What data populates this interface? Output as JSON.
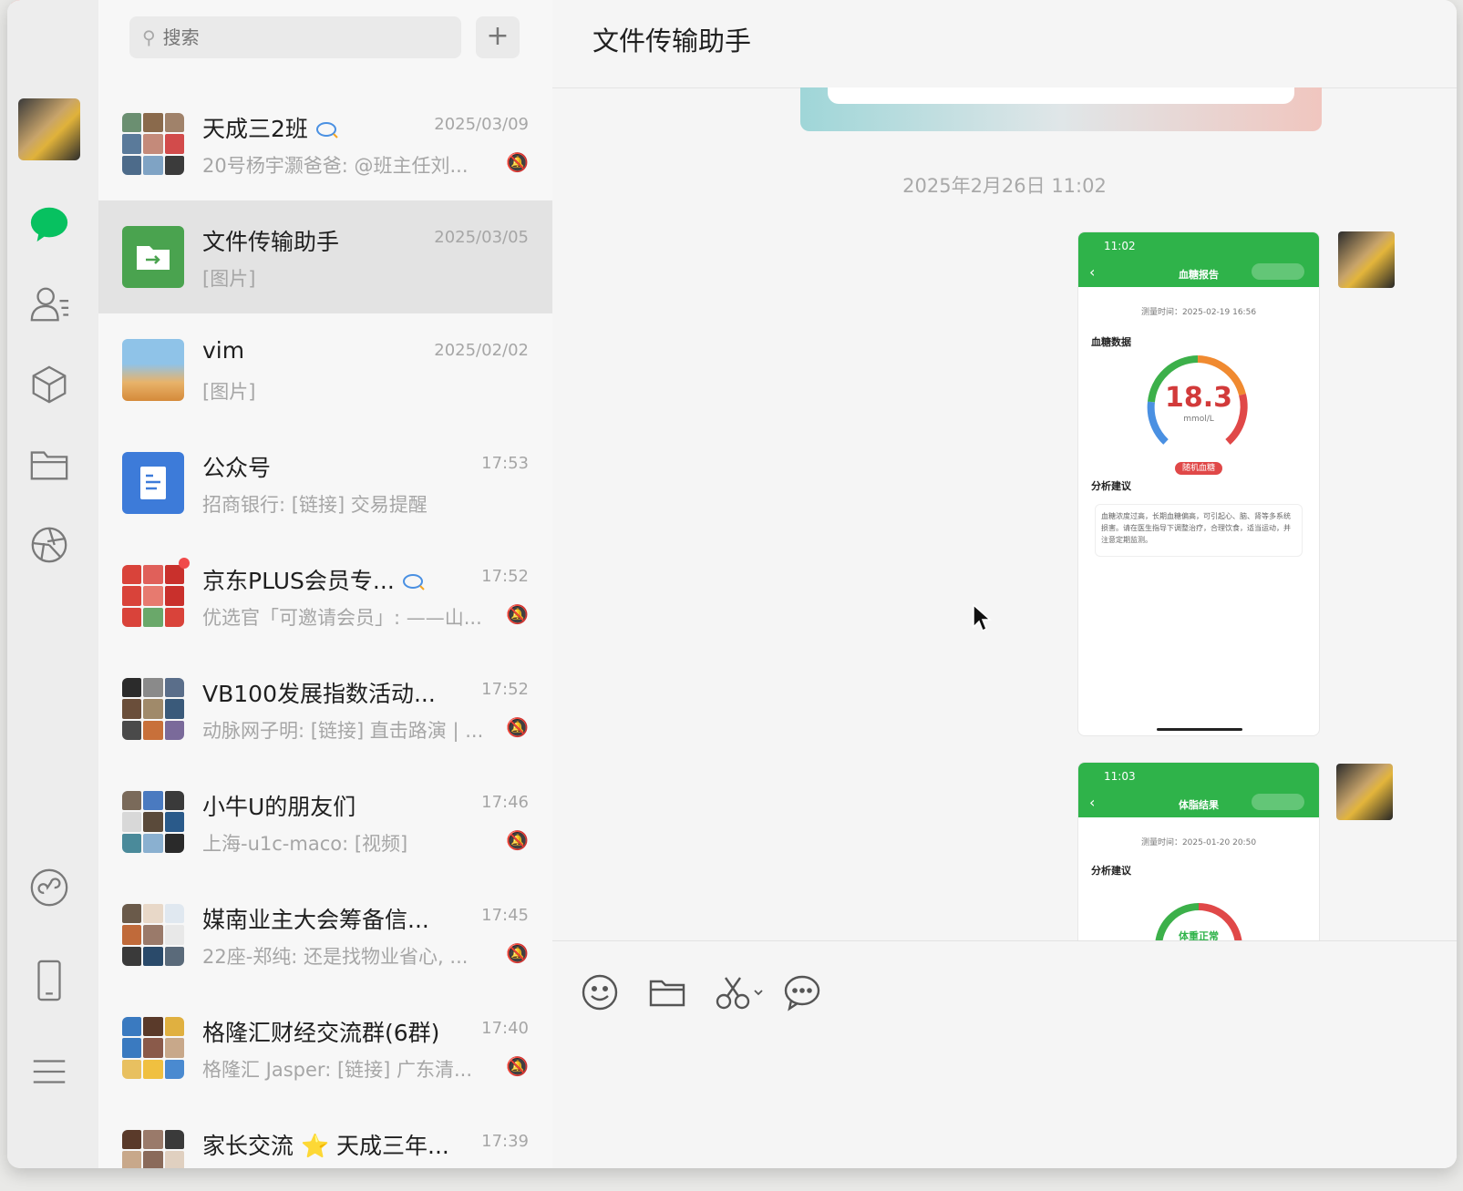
{
  "search": {
    "placeholder": "搜索"
  },
  "chat": {
    "title": "文件传输助手",
    "timestamp": "2025年2月26日 11:02",
    "messages": [
      {
        "status_time": "11:02",
        "page_title": "血糖报告",
        "measure_time": "测量时间：2025-02-19 16:56",
        "section1": "血糖数据",
        "value": "18.3",
        "unit": "mmol/L",
        "badge": "随机血糖",
        "section2": "分析建议",
        "advice": "血糖浓度过高，长期血糖偏高，可引起心、脑、肾等多系统损害。请在医生指导下调整治疗，合理饮食，适当运动，并注意定期监测。"
      },
      {
        "status_time": "11:03",
        "page_title": "体脂结果",
        "measure_time": "测量时间：2025-01-20 20:50",
        "section": "分析建议",
        "badge": "体重正常"
      }
    ]
  },
  "conversations": [
    {
      "name": "天成三2班",
      "time": "2025/03/09",
      "preview": "20号杨宇灏爸爸: @班主任刘...",
      "muted": true,
      "has_bubble": true
    },
    {
      "name": "文件传输助手",
      "time": "2025/03/05",
      "preview": "[图片]",
      "muted": false,
      "active": true
    },
    {
      "name": "vim",
      "time": "2025/02/02",
      "preview": "[图片]",
      "muted": false
    },
    {
      "name": "公众号",
      "time": "17:53",
      "preview": "招商银行: [链接] 交易提醒",
      "muted": false
    },
    {
      "name": "京东PLUS会员专...",
      "time": "17:52",
      "preview": "优选官「可邀请会员」: ——山...",
      "muted": true,
      "has_bubble": true,
      "unread_dot": true
    },
    {
      "name": "VB100发展指数活动...",
      "time": "17:52",
      "preview": "动脉网子明: [链接] 直击路演 | ...",
      "muted": true
    },
    {
      "name": "小牛U的朋友们",
      "time": "17:46",
      "preview": "上海-u1c-maco: [视频]",
      "muted": true
    },
    {
      "name": "媒南业主大会筹备信...",
      "time": "17:45",
      "preview": "22座-郑纯: 还是找物业省心, ...",
      "muted": true
    },
    {
      "name": "格隆汇财经交流群(6群)",
      "time": "17:40",
      "preview": "格隆汇 Jasper: [链接] 广东清...",
      "muted": true
    },
    {
      "name": "家长交流 ⭐ 天成三年...",
      "time": "17:39",
      "preview": "",
      "muted": false
    }
  ],
  "colors": {
    "accent": "#07c160",
    "phone_green": "#2fb34a",
    "gauge_red": "#e04848",
    "gauge_blue": "#4a90e2"
  },
  "icons": {
    "nav": [
      "chat-icon",
      "contacts-icon",
      "favorites-box-icon",
      "files-folder-icon",
      "moments-aperture-icon",
      "mini-program-icon",
      "phone-icon",
      "menu-icon"
    ],
    "toolbar": [
      "emoji-icon",
      "folder-icon",
      "scissors-icon",
      "chat-history-icon"
    ]
  }
}
